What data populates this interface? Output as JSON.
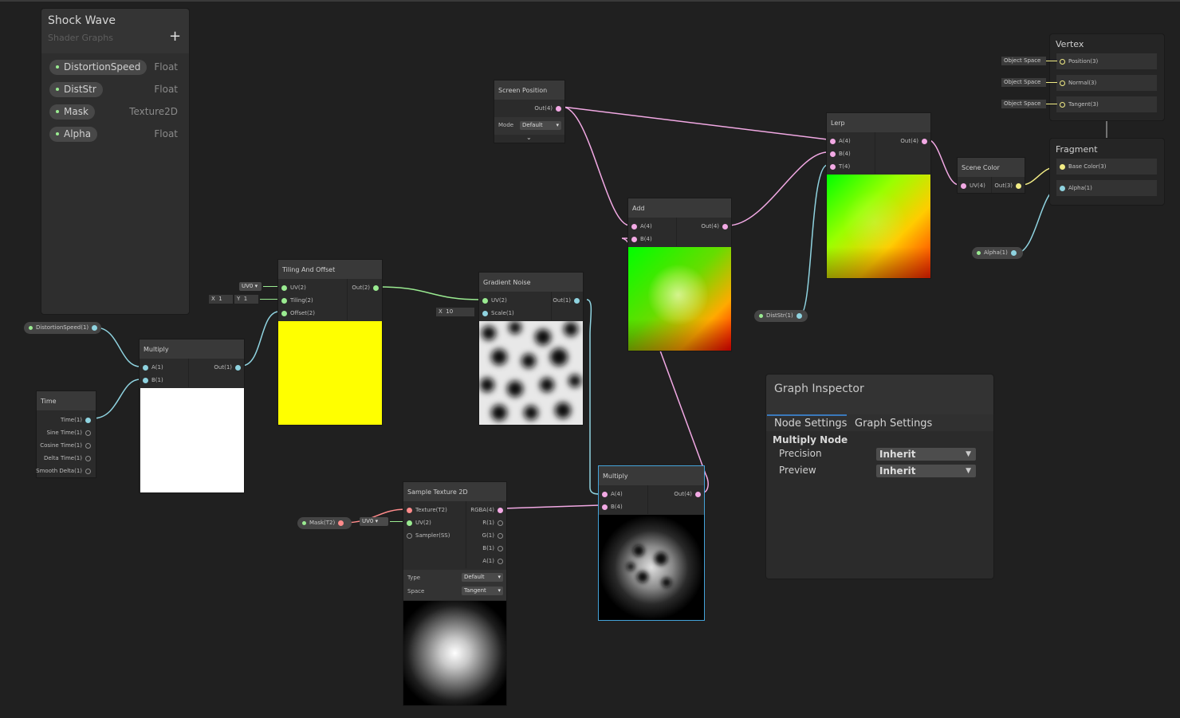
{
  "blackboard": {
    "title": "Shock Wave",
    "subtitle": "Shader Graphs",
    "add_label": "+",
    "properties": [
      {
        "name": "DistortionSpeed",
        "type": "Float"
      },
      {
        "name": "DistStr",
        "type": "Float"
      },
      {
        "name": "Mask",
        "type": "Texture2D"
      },
      {
        "name": "Alpha",
        "type": "Float"
      }
    ]
  },
  "nodes": {
    "time": {
      "title": "Time",
      "outputs": [
        "Time(1)",
        "Sine Time(1)",
        "Cosine Time(1)",
        "Delta Time(1)",
        "Smooth Delta(1)"
      ]
    },
    "multiply1": {
      "title": "Multiply",
      "in_a": "A(1)",
      "in_b": "B(1)",
      "out": "Out(1)"
    },
    "tiling": {
      "title": "Tiling And Offset",
      "in_uv": "UV(2)",
      "in_tiling": "Tiling(2)",
      "in_offset": "Offset(2)",
      "out": "Out(2)",
      "uv_channel": "UV0",
      "tiling_x_label": "X",
      "tiling_x": "1",
      "tiling_y_label": "Y",
      "tiling_y": "1"
    },
    "gradient_noise": {
      "title": "Gradient Noise",
      "in_uv": "UV(2)",
      "in_scale": "Scale(1)",
      "out": "Out(1)",
      "scale_label": "X",
      "scale_value": "10"
    },
    "screen_position": {
      "title": "Screen Position",
      "out": "Out(4)",
      "mode_label": "Mode",
      "mode_value": "Default",
      "expand_icon": "chevron-down"
    },
    "add": {
      "title": "Add",
      "in_a": "A(4)",
      "in_b": "B(4)",
      "out": "Out(4)"
    },
    "lerp": {
      "title": "Lerp",
      "in_a": "A(4)",
      "in_b": "B(4)",
      "in_t": "T(4)",
      "out": "Out(4)"
    },
    "scene_color": {
      "title": "Scene Color",
      "in_uv": "UV(4)",
      "out": "Out(3)"
    },
    "sample_texture": {
      "title": "Sample Texture 2D",
      "in_tex": "Texture(T2)",
      "in_uv": "UV(2)",
      "in_sampler": "Sampler(SS)",
      "outputs": [
        "RGBA(4)",
        "R(1)",
        "G(1)",
        "B(1)",
        "A(1)"
      ],
      "uv_channel": "UV0",
      "type_label": "Type",
      "type_value": "Default",
      "space_label": "Space",
      "space_value": "Tangent"
    },
    "multiply2": {
      "title": "Multiply",
      "in_a": "A(4)",
      "in_b": "B(4)",
      "out": "Out(4)"
    }
  },
  "property_pills": {
    "distortion_speed": "DistortionSpeed(1)",
    "mask": "Mask(T2)",
    "dist_str": "DistStr(1)",
    "alpha": "Alpha(1)"
  },
  "master_stack": {
    "vertex_title": "Vertex",
    "vertex_rows": [
      {
        "space": "Object Space",
        "label": "Position(3)"
      },
      {
        "space": "Object Space",
        "label": "Normal(3)"
      },
      {
        "space": "Object Space",
        "label": "Tangent(3)"
      }
    ],
    "fragment_title": "Fragment",
    "fragment_rows": [
      "Base Color(3)",
      "Alpha(1)"
    ]
  },
  "inspector": {
    "title": "Graph Inspector",
    "tabs": [
      "Node Settings",
      "Graph Settings"
    ],
    "active_tab": "Node Settings",
    "section": "Multiply Node",
    "fields": [
      {
        "label": "Precision",
        "value": "Inherit"
      },
      {
        "label": "Preview",
        "value": "Inherit"
      }
    ]
  },
  "colors": {
    "canvas": "#202020",
    "float_port": "#8fd3e0",
    "vector2_port": "#9aeb91",
    "vector3_port": "#f2ec85",
    "vector4_port": "#f2a9e4",
    "texture_port": "#ff8b8b",
    "selection": "#44a3d9",
    "tiling_preview": "#ffff00"
  }
}
